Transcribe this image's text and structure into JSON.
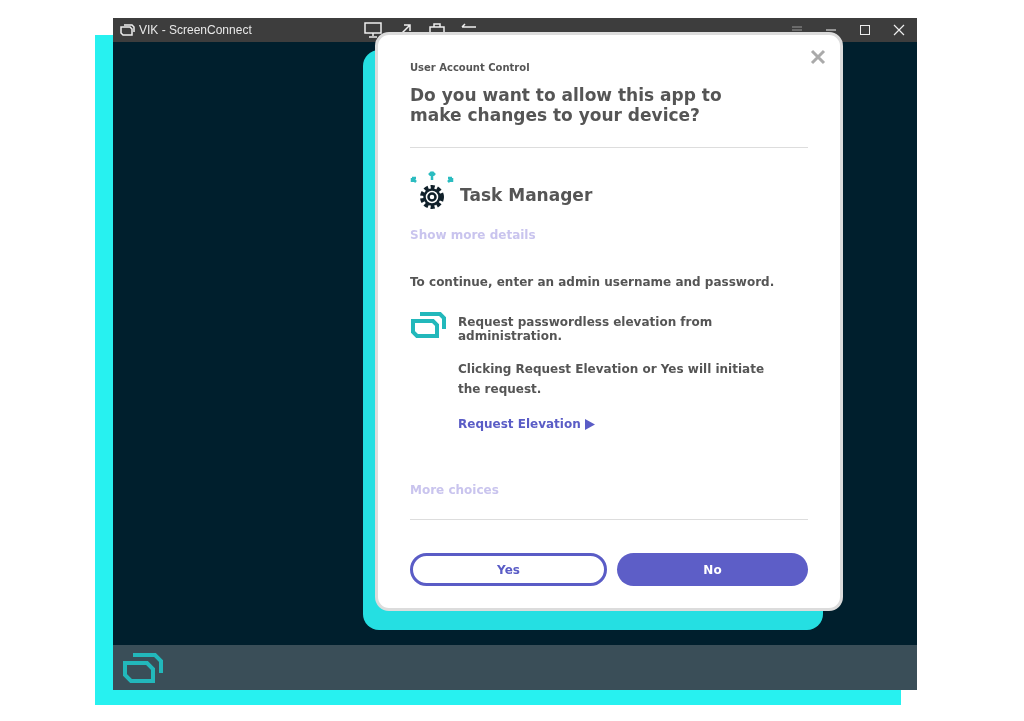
{
  "window": {
    "title": "VIK - ScreenConnect"
  },
  "dialog": {
    "caption": "User Account Control",
    "question": "Do you want to allow this app to make changes to your device?",
    "app_name": "Task Manager",
    "details_link": "Show more details",
    "instruction": "To continue, enter an admin username and password.",
    "option": {
      "text": "Request passwordless elevation from administration.",
      "note": "Clicking Request Elevation or Yes will initiate the request.",
      "link": "Request Elevation"
    },
    "more_choices": "More choices",
    "buttons": [
      {
        "label": "Yes",
        "kind": "outline"
      },
      {
        "label": "No",
        "kind": "filled"
      }
    ]
  }
}
